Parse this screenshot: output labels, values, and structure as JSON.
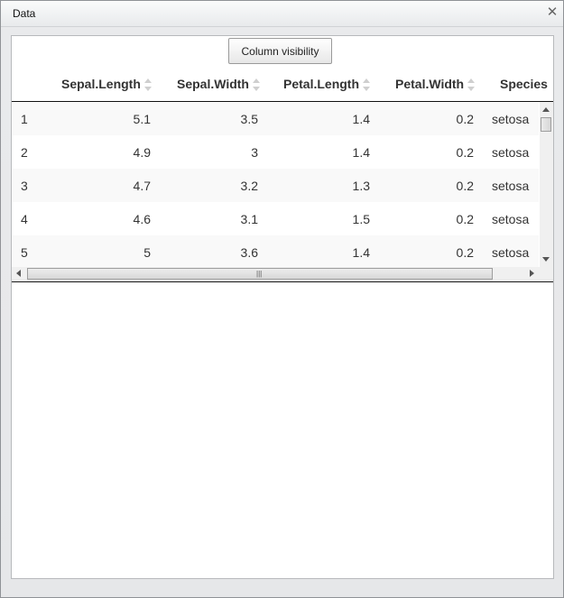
{
  "window": {
    "title": "Data",
    "close_glyph": "✕"
  },
  "toolbar": {
    "column_visibility_label": "Column visibility"
  },
  "table": {
    "columns": [
      {
        "label": ""
      },
      {
        "label": "Sepal.Length"
      },
      {
        "label": "Sepal.Width"
      },
      {
        "label": "Petal.Length"
      },
      {
        "label": "Petal.Width"
      },
      {
        "label": "Species"
      }
    ],
    "rows": [
      [
        "1",
        "5.1",
        "3.5",
        "1.4",
        "0.2",
        "setosa"
      ],
      [
        "2",
        "4.9",
        "3",
        "1.4",
        "0.2",
        "setosa"
      ],
      [
        "3",
        "4.7",
        "3.2",
        "1.3",
        "0.2",
        "setosa"
      ],
      [
        "4",
        "4.6",
        "3.1",
        "1.5",
        "0.2",
        "setosa"
      ],
      [
        "5",
        "5",
        "3.6",
        "1.4",
        "0.2",
        "setosa"
      ]
    ]
  },
  "scrollbar": {
    "h_grip": "|||"
  }
}
